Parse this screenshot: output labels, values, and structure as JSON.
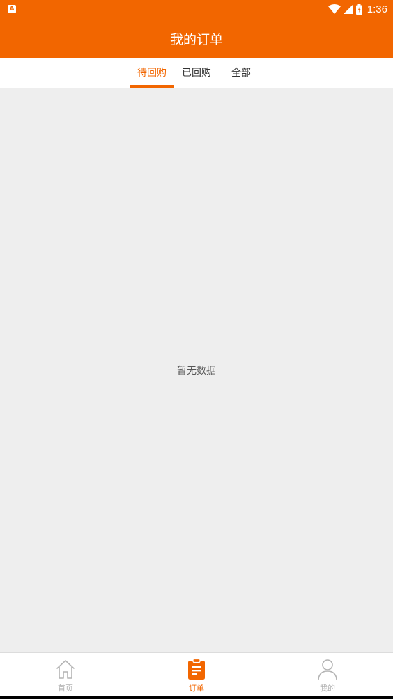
{
  "status_bar": {
    "time": "1:36",
    "app_badge": "A"
  },
  "header": {
    "title": "我的订单"
  },
  "tabs": [
    {
      "label": "待回购",
      "active": true
    },
    {
      "label": "已回购",
      "active": false
    },
    {
      "label": "全部",
      "active": false
    }
  ],
  "content": {
    "empty_text": "暂无数据"
  },
  "bottom_nav": [
    {
      "label": "首页",
      "icon": "home-icon",
      "active": false
    },
    {
      "label": "订单",
      "icon": "clipboard-icon",
      "active": true
    },
    {
      "label": "我的",
      "icon": "person-icon",
      "active": false
    }
  ],
  "colors": {
    "accent": "#f26600",
    "background": "#eeeeee",
    "inactive": "#b3b3b3"
  }
}
